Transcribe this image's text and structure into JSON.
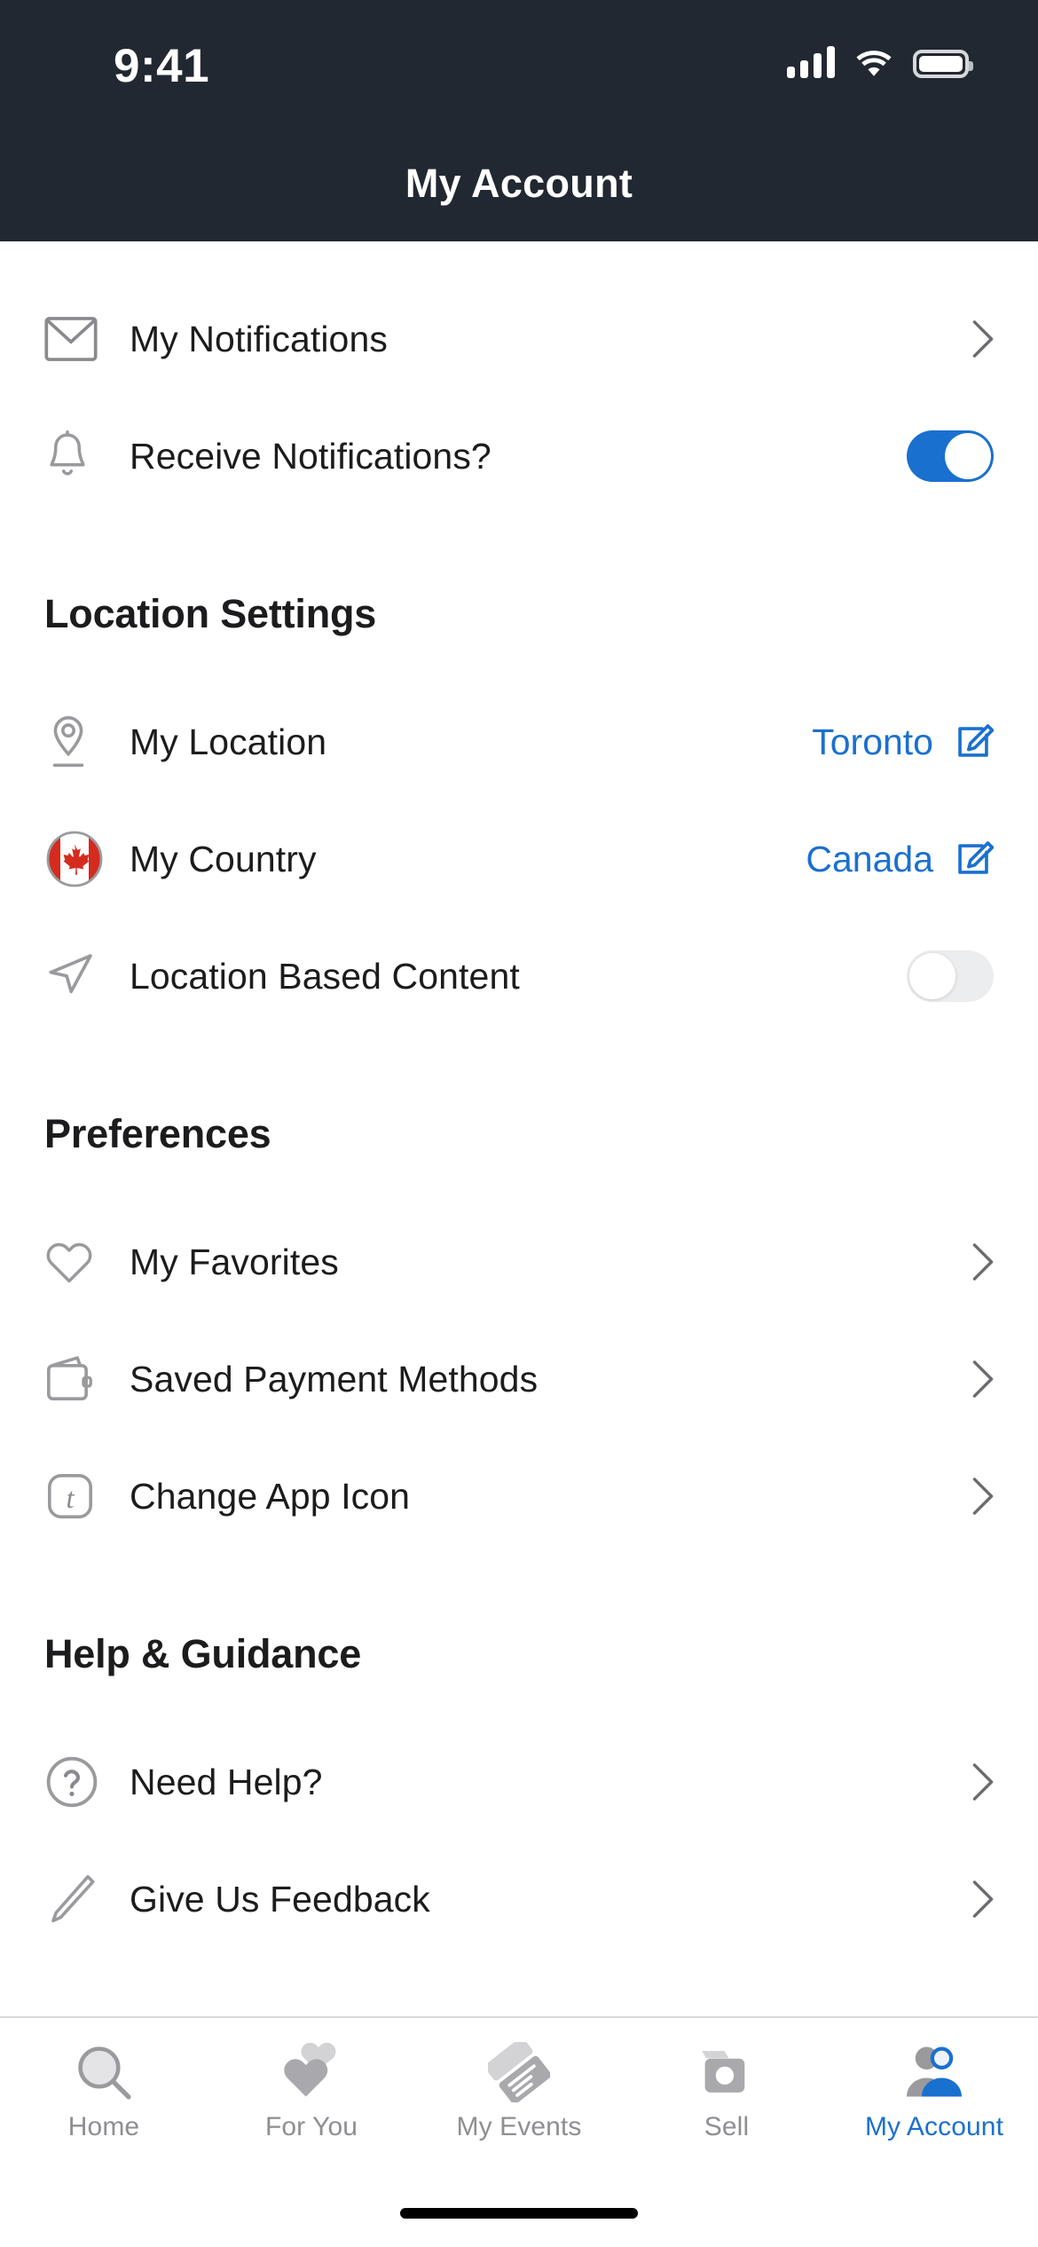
{
  "status_bar": {
    "time": "9:41",
    "signal_icon": "signal-bars-icon",
    "wifi_icon": "wifi-icon",
    "battery_icon": "battery-full-icon"
  },
  "header": {
    "title": "My Account",
    "background_color": "#222831"
  },
  "theme": {
    "accent_color": "#1a70cf",
    "toggle_on_color": "#1a70cf",
    "toggle_off_color": "#ecedef",
    "text_color": "#1c1c1e",
    "muted_color": "#8e8e93",
    "flag_red": "#d52b1e"
  },
  "sections": [
    {
      "title": "",
      "rows": [
        {
          "icon": "envelope-icon",
          "label": "My Notifications",
          "accessory": "chevron"
        },
        {
          "icon": "bell-icon",
          "label": "Receive Notifications?",
          "accessory": "toggle",
          "toggle_state": "on"
        }
      ]
    },
    {
      "title": "Location Settings",
      "rows": [
        {
          "icon": "map-pin-icon",
          "label": "My Location",
          "accessory": "value-edit",
          "value": "Toronto"
        },
        {
          "icon": "canada-flag-icon",
          "label": "My Country",
          "accessory": "value-edit",
          "value": "Canada"
        },
        {
          "icon": "navigation-arrow-icon",
          "label": "Location Based Content",
          "accessory": "toggle",
          "toggle_state": "off"
        }
      ]
    },
    {
      "title": "Preferences",
      "rows": [
        {
          "icon": "heart-icon",
          "label": "My Favorites",
          "accessory": "chevron"
        },
        {
          "icon": "wallet-icon",
          "label": "Saved Payment Methods",
          "accessory": "chevron"
        },
        {
          "icon": "app-icon-t",
          "label": "Change App Icon",
          "accessory": "chevron"
        }
      ]
    },
    {
      "title": "Help & Guidance",
      "rows": [
        {
          "icon": "question-circle-icon",
          "label": "Need Help?",
          "accessory": "chevron"
        },
        {
          "icon": "pencil-icon",
          "label": "Give Us Feedback",
          "accessory": "chevron"
        }
      ]
    }
  ],
  "tab_bar": {
    "items": [
      {
        "icon": "search-icon",
        "label": "Home",
        "active": false
      },
      {
        "icon": "hearts-icon",
        "label": "For You",
        "active": false
      },
      {
        "icon": "tickets-icon",
        "label": "My Events",
        "active": false
      },
      {
        "icon": "camera-icon",
        "label": "Sell",
        "active": false
      },
      {
        "icon": "person-icon",
        "label": "My Account",
        "active": true
      }
    ]
  }
}
